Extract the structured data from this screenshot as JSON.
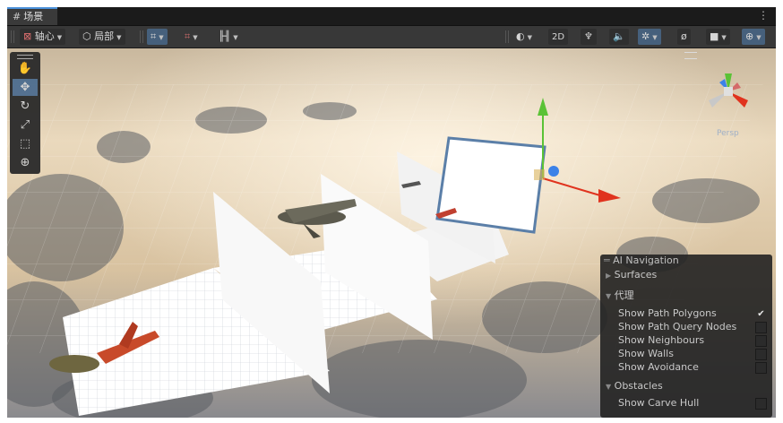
{
  "tab": {
    "title": "场景",
    "icon": "grid-hash-icon"
  },
  "toolbar": {
    "pivot_label": "轴心",
    "local_label": "局部",
    "right_2d_label": "2D"
  },
  "viewport": {
    "camera_label": "Persp"
  },
  "ai_overlay": {
    "title": "AI Navigation",
    "surfaces": "Surfaces",
    "agent_section": "代理",
    "items": [
      {
        "label": "Show Path Polygons",
        "checked": true
      },
      {
        "label": "Show Path Query Nodes",
        "checked": false
      },
      {
        "label": "Show Neighbours",
        "checked": false
      },
      {
        "label": "Show Walls",
        "checked": false
      },
      {
        "label": "Show Avoidance",
        "checked": false
      }
    ],
    "obstacles_section": "Obstacles",
    "obstacle_items": [
      {
        "label": "Show Carve Hull",
        "checked": false
      }
    ]
  },
  "colors": {
    "accent": "#4a90d9",
    "active_tool": "#4d6d8f",
    "axis_x": "#e0331e",
    "axis_y": "#5bc236",
    "axis_z": "#3c82e8"
  }
}
